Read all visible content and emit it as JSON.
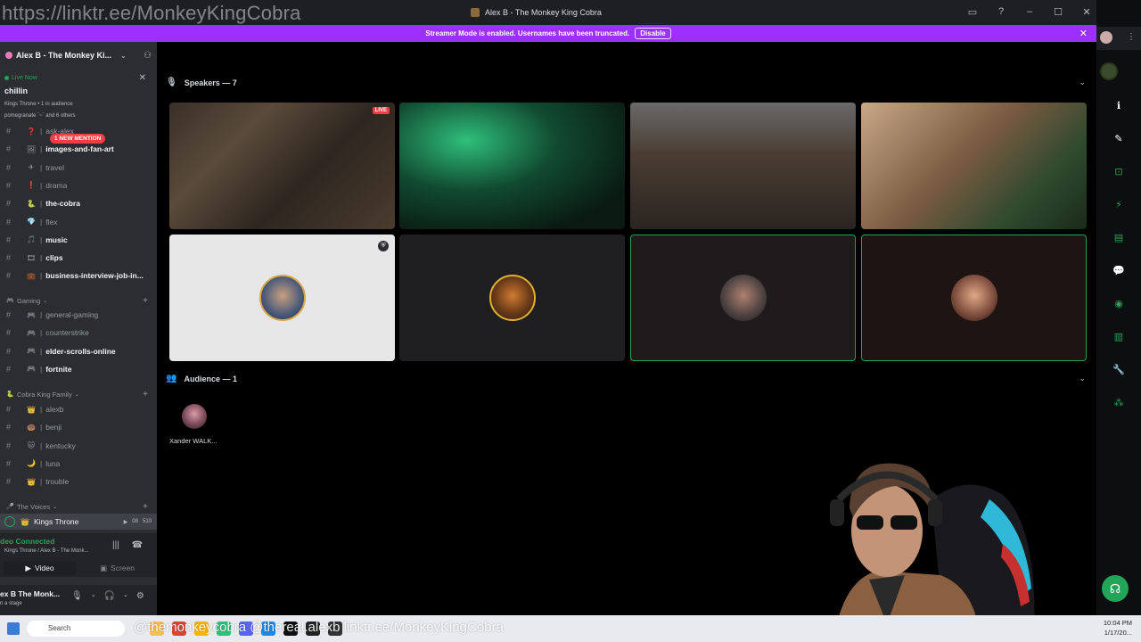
{
  "overlay": {
    "url_watermark": "https://linktr.ee/MonkeyKingCobra",
    "taskbar_overlay": "@themonkeycobra   @thereal.alexb   linktr.ee/MonkeyKingCobra"
  },
  "window": {
    "title": "Alex B - The Monkey King Cobra"
  },
  "banner": {
    "text": "Streamer Mode is enabled. Usernames have been truncated.",
    "button": "Disable",
    "color": "#9b30ff"
  },
  "server": {
    "name": "Alex B - The Monkey Ki..."
  },
  "live": {
    "label": "Live Now",
    "title": "chillin",
    "sub1": "Kings Throne • 1 in audience",
    "sub2": "pomegranate `~` and 6 others"
  },
  "mention_badge": "1 NEW MENTION",
  "channels": [
    {
      "emoji": "❓",
      "name": "ask-alex",
      "bright": false
    },
    {
      "emoji": "🖼",
      "name": "images-and-fan-art",
      "bright": true
    },
    {
      "emoji": "✈",
      "name": "travel",
      "bright": false
    },
    {
      "emoji": "❗",
      "name": "drama",
      "bright": false
    },
    {
      "emoji": "🐍",
      "name": "the-cobra",
      "bright": true
    },
    {
      "emoji": "💎",
      "name": "flex",
      "bright": false
    },
    {
      "emoji": "🎵",
      "name": "music",
      "bright": true
    },
    {
      "emoji": "🎞",
      "name": "clips",
      "bright": true
    },
    {
      "emoji": "💼",
      "name": "business-interview-job-in...",
      "bright": true
    }
  ],
  "categories": {
    "gaming": {
      "label": "Gaming",
      "emoji": "🎮"
    },
    "family": {
      "label": "Cobra King Family",
      "emoji": "🐍"
    },
    "voices": {
      "label": "The Voices",
      "emoji": "🎤"
    }
  },
  "gaming_channels": [
    {
      "emoji": "🎮",
      "name": "general-gaming",
      "bright": false
    },
    {
      "emoji": "🎮",
      "name": "counterstrike",
      "bright": false
    },
    {
      "emoji": "🎮",
      "name": "elder-scrolls-online",
      "bright": true
    },
    {
      "emoji": "🎮",
      "name": "fortnite",
      "bright": true
    }
  ],
  "family_channels": [
    {
      "emoji": "👑",
      "name": "alexb",
      "bright": false
    },
    {
      "emoji": "🍩",
      "name": "benji",
      "bright": false
    },
    {
      "emoji": "🐱",
      "name": "kentucky",
      "bright": false
    },
    {
      "emoji": "🌙",
      "name": "luna",
      "bright": false
    },
    {
      "emoji": "👑",
      "name": "trouble",
      "bright": false
    }
  ],
  "voice": {
    "emoji": "👑",
    "name": "Kings Throne",
    "count_a": "08",
    "count_b": "510"
  },
  "connected": {
    "title": "deo Connected",
    "sub": "Kings Throne / Alex B - The Monk..."
  },
  "video_tabs": {
    "video": "Video",
    "screen": "Screen"
  },
  "user": {
    "name": "ex B The Monk...",
    "status": "n a stage"
  },
  "speakers": {
    "label": "Speakers — 7"
  },
  "audience": {
    "label": "Audience — 1",
    "members": [
      {
        "name": "Xander WALK..."
      }
    ]
  },
  "tiles": {
    "live_badge": "LIVE"
  },
  "taskbar": {
    "search": "Search",
    "time": "10:04 PM",
    "date": "1/17/20..."
  }
}
